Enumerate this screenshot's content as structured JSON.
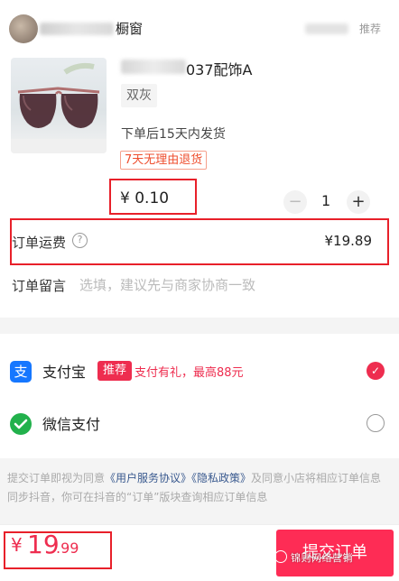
{
  "shop": {
    "name": "橱窗",
    "recommend_label": "推荐"
  },
  "product": {
    "title": "037配饰A",
    "variant": "双灰",
    "shipping_note": "下单后15天内发货",
    "return_tag": "7天无理由退货",
    "price": "¥ 0.10",
    "quantity": {
      "minus": "−",
      "value": "1",
      "plus": "+"
    }
  },
  "shipping": {
    "label": "订单运费",
    "help_icon": "question-circle-icon",
    "fee": "¥19.89"
  },
  "message": {
    "label": "订单留言",
    "placeholder": "选填，建议先与商家协商一致"
  },
  "payment": {
    "alipay": {
      "icon": "alipay-icon",
      "glyph": "支",
      "name": "支付宝",
      "badge": "推荐",
      "promo": "支付有礼，最高88元",
      "selected": true
    },
    "wechat": {
      "icon": "wechat-pay-icon",
      "name": "微信支付",
      "selected": false
    }
  },
  "agreement": {
    "prefix": "提交订单即视为同意",
    "link1": "《用户服务协议》",
    "link2": "《隐私政策》",
    "suffix": "及同意小店将相应订单信息同步抖音，你可在抖音的“订单”版块查询相应订单信息"
  },
  "footer": {
    "total_symbol": "¥",
    "total_int": "19",
    "total_dec": ".99",
    "submit_label": "提交订单",
    "watermark": "锦则网络营销"
  },
  "colors": {
    "accent": "#fe2c55",
    "highlight_box": "#e8202a",
    "alipay": "#1677ff",
    "wechat": "#22b14c"
  }
}
